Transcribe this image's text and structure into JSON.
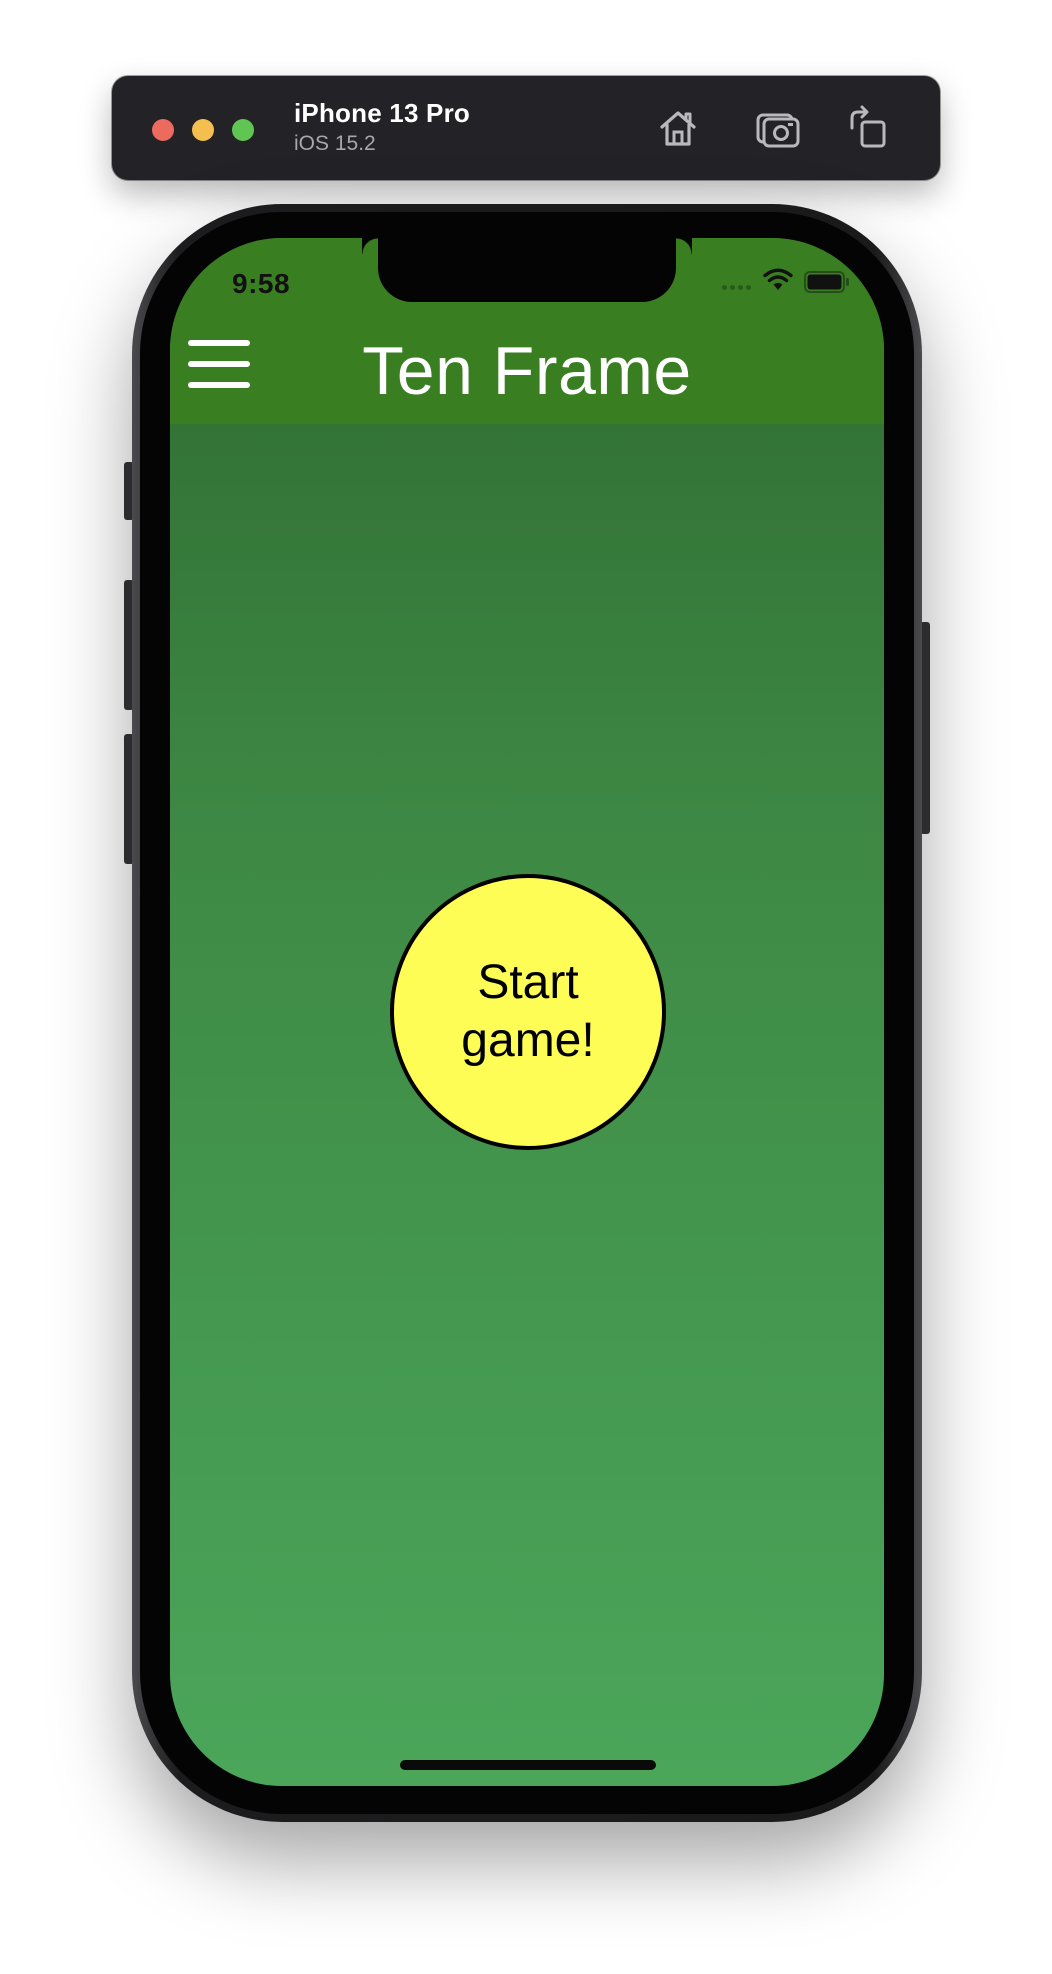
{
  "simulator": {
    "device_name": "iPhone 13 Pro",
    "os_version": "iOS 15.2",
    "toolbar_icons": [
      "home-icon",
      "screenshot-icon",
      "rotate-icon"
    ]
  },
  "status_bar": {
    "time": "9:58"
  },
  "header": {
    "title": "Ten Frame",
    "menu_icon": "hamburger-menu-icon",
    "background_color": "#3a7e22"
  },
  "main": {
    "start_button_label": "Start game!",
    "start_button_color": "#fdfd55",
    "background_gradient": [
      "#2e6a30",
      "#4ba65a"
    ]
  }
}
